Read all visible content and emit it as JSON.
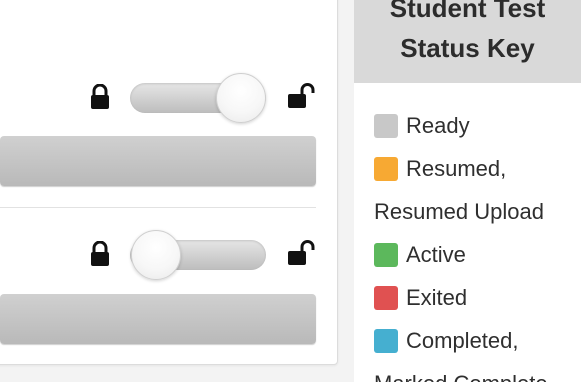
{
  "status_key": {
    "title_line1": "Student Test",
    "title_line2": "Status Key",
    "items": [
      {
        "label": "Ready",
        "color": "#c8c8c8"
      },
      {
        "label": "Resumed,",
        "color": "#f7a933",
        "continuation": "Resumed Upload"
      },
      {
        "label": "Active",
        "color": "#5cb85c"
      },
      {
        "label": "Exited",
        "color": "#e05151"
      },
      {
        "label": "Completed,",
        "color": "#45afd0",
        "continuation": "Marked Complete"
      }
    ]
  },
  "lock_toggles": [
    {
      "state": "unlocked",
      "lock_icon": "lock-icon",
      "unlock_icon": "unlock-icon"
    },
    {
      "state": "locked",
      "lock_icon": "lock-icon",
      "unlock_icon": "unlock-icon"
    }
  ]
}
